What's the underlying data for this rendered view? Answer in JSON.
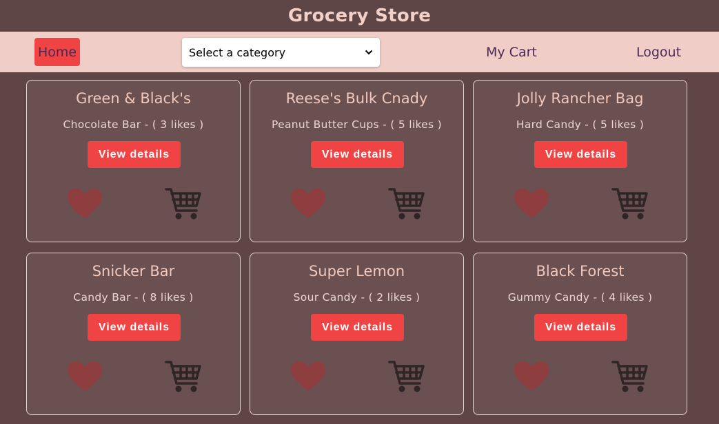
{
  "header": {
    "title": "Grocery Store"
  },
  "nav": {
    "home_label": "Home",
    "category_select": {
      "selected": "Select a category"
    },
    "cart_label": "My Cart",
    "logout_label": "Logout"
  },
  "products": [
    {
      "name": "Green & Black's",
      "description": "Chocolate Bar - ( 3 likes )",
      "button_label": "View details"
    },
    {
      "name": "Reese's Bulk Cnady",
      "description": "Peanut Butter Cups - ( 5 likes )",
      "button_label": "View details"
    },
    {
      "name": "Jolly Rancher Bag",
      "description": "Hard Candy - ( 5 likes )",
      "button_label": "View details"
    },
    {
      "name": "Snicker Bar",
      "description": "Candy Bar - ( 8 likes )",
      "button_label": "View details"
    },
    {
      "name": "Super Lemon",
      "description": "Sour Candy - ( 2 likes )",
      "button_label": "View details"
    },
    {
      "name": "Black Forest",
      "description": "Gummy Candy - ( 4 likes )",
      "button_label": "View details"
    }
  ],
  "icons": {
    "like": "heart-icon",
    "add_to_cart": "shopping-cart-icon",
    "select_chevron": "chevron-down-icon"
  },
  "colors": {
    "page_background": "#5f4545",
    "navbar_background": "#f1cdc7",
    "accent": "#f04444",
    "card_background": "#6a5050",
    "heart": "#8e3e3e",
    "cart": "#2f2526"
  }
}
